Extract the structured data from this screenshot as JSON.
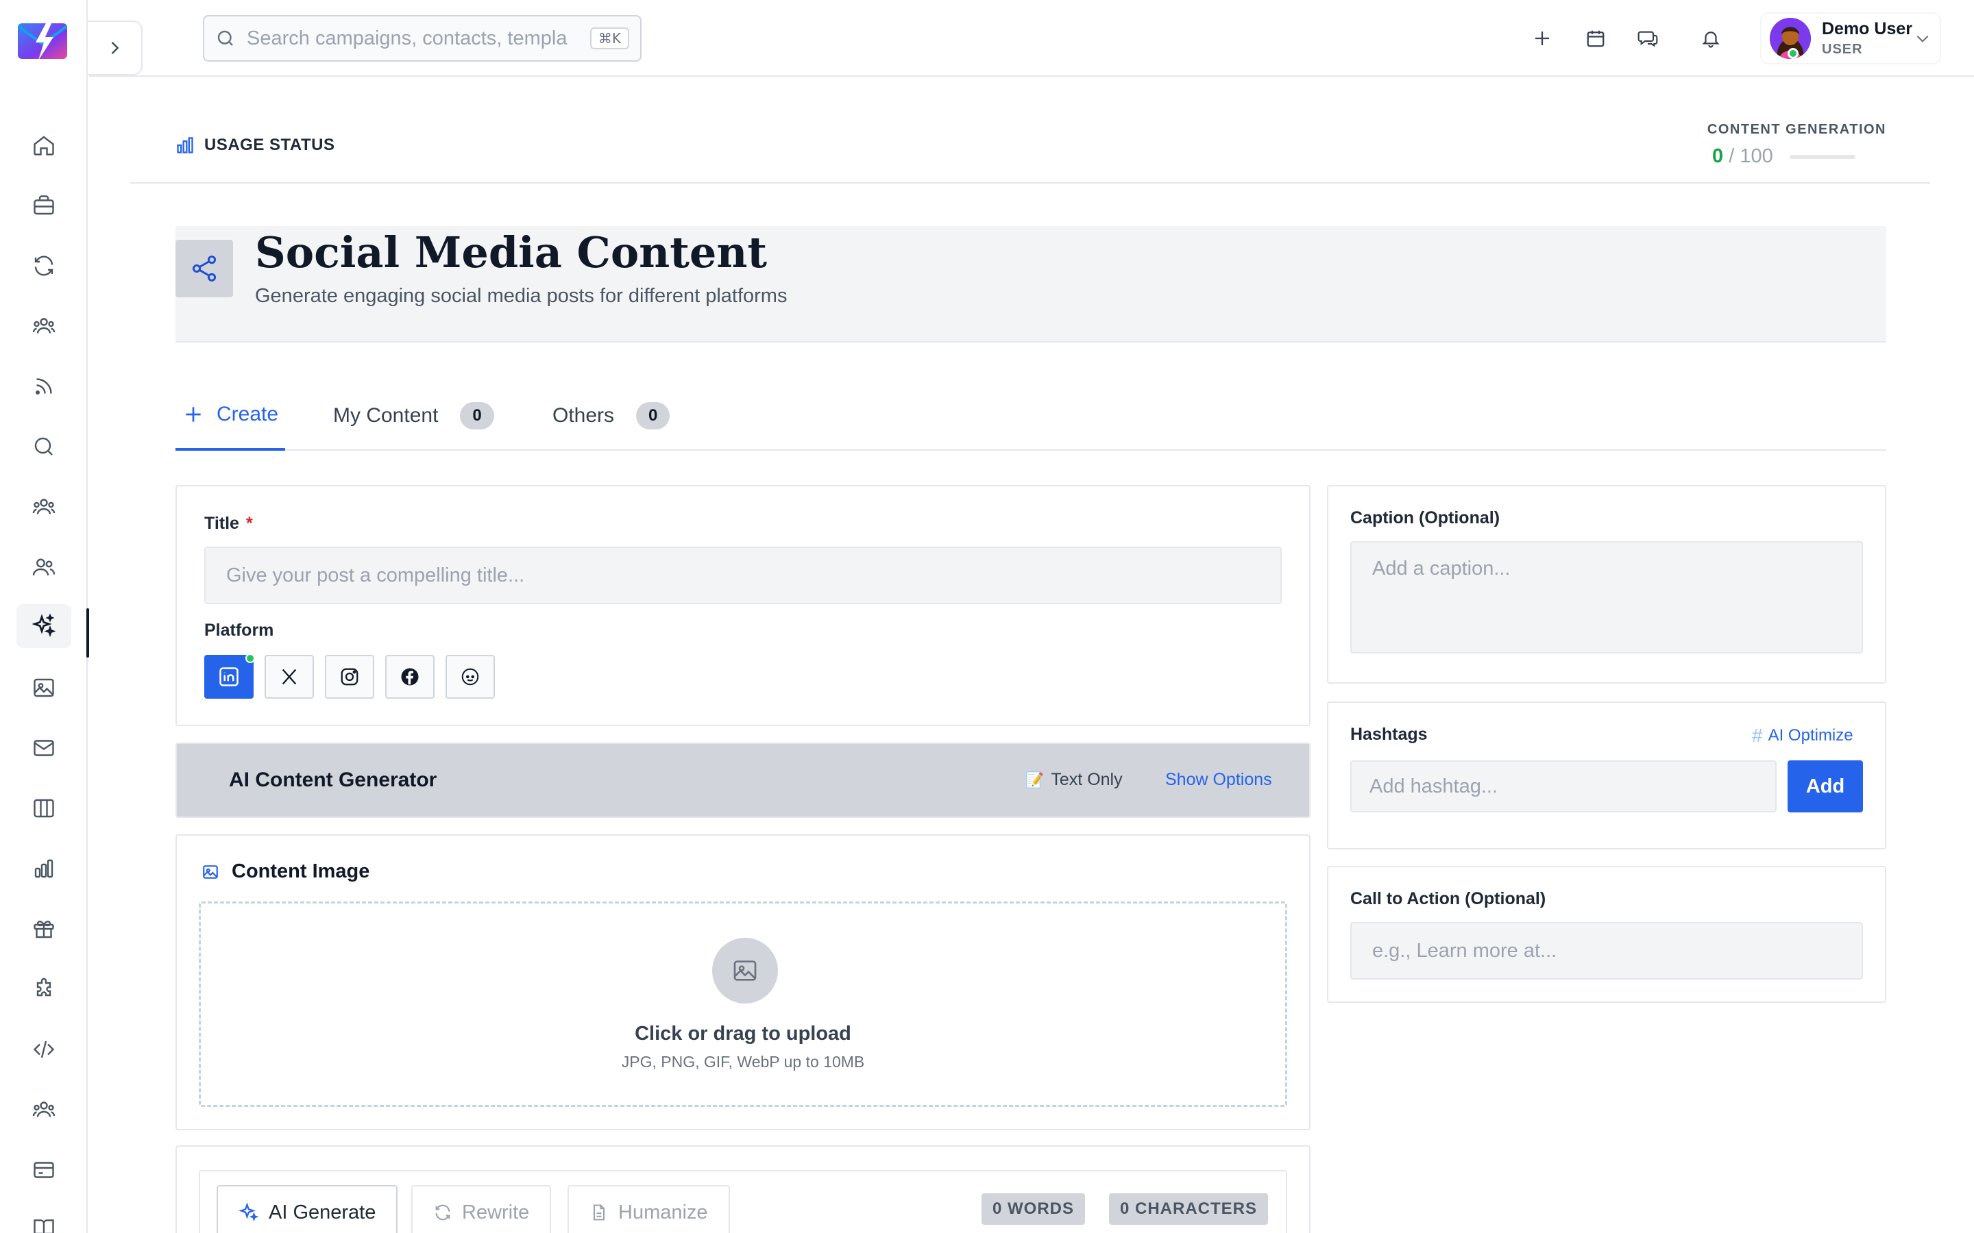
{
  "search": {
    "placeholder": "Search campaigns, contacts, templa",
    "shortcut": "⌘K"
  },
  "user": {
    "name": "Demo User",
    "role": "USER"
  },
  "usage": {
    "label": "USAGE STATUS",
    "metric_label": "CONTENT GENERATION",
    "used": "0",
    "limit": "/ 100",
    "progress": 0
  },
  "hero": {
    "title": "Social Media Content",
    "subtitle": "Generate engaging social media posts for different platforms"
  },
  "tabs": [
    {
      "label": "Create"
    },
    {
      "label": "My Content",
      "count": "0"
    },
    {
      "label": "Others",
      "count": "0"
    }
  ],
  "form": {
    "title_label": "Title",
    "title_required": "*",
    "title_placeholder": "Give your post a compelling title...",
    "platform_label": "Platform",
    "platforms": [
      "linkedin",
      "x",
      "instagram",
      "facebook",
      "reddit"
    ],
    "selected_platform": "linkedin"
  },
  "ai_generator": {
    "title": "AI Content Generator",
    "mode": "Text Only",
    "mode_icon": "📝",
    "show_options": "Show Options"
  },
  "content_image": {
    "title": "Content Image",
    "upload_title": "Click or drag to upload",
    "upload_sub": "JPG, PNG, GIF, WebP up to 10MB"
  },
  "editor": {
    "ai_generate": "AI Generate",
    "rewrite": "Rewrite",
    "humanize": "Humanize",
    "words": "0 WORDS",
    "characters": "0 CHARACTERS"
  },
  "caption": {
    "label": "Caption (Optional)",
    "placeholder": "Add a caption..."
  },
  "hashtags": {
    "label": "Hashtags",
    "ai_optimize": "AI Optimize",
    "placeholder": "Add hashtag...",
    "add": "Add"
  },
  "cta": {
    "label": "Call to Action (Optional)",
    "placeholder": "e.g., Learn more at..."
  },
  "colors": {
    "accent": "#2563eb",
    "success": "#16a34a",
    "danger": "#dc2626"
  },
  "sidebar_icons": [
    "home-icon",
    "briefcase-icon",
    "refresh-icon",
    "users-group-icon",
    "rss-icon",
    "search-icon",
    "users-group-icon",
    "users-icon",
    "sparkles-icon",
    "image-icon",
    "mail-icon",
    "columns-icon",
    "bar-chart-icon",
    "gift-icon",
    "puzzle-icon",
    "code-icon",
    "users-group-icon",
    "credit-card-icon",
    "book-icon"
  ]
}
